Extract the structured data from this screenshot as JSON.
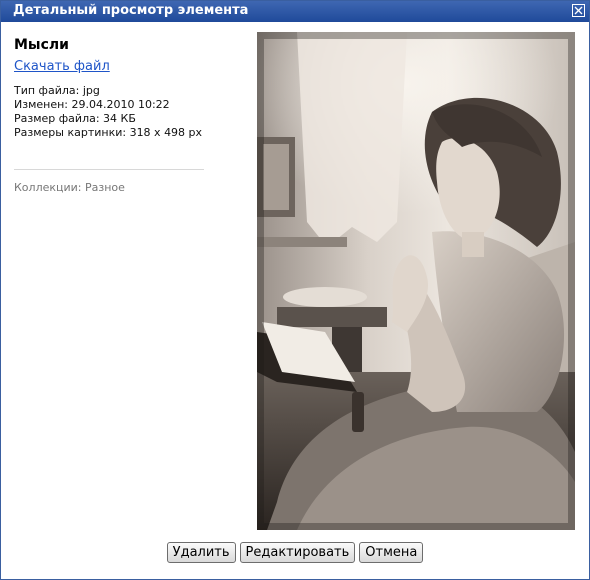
{
  "window": {
    "title": "Детальный просмотр элемента"
  },
  "item": {
    "name": "Мысли",
    "download_label": "Скачать файл",
    "file_type": "Тип файла: jpg",
    "modified": "Изменен: 29.04.2010 10:22",
    "file_size": "Размер файла: 34 КБ",
    "image_size": "Размеры картинки: 318 x 498 px",
    "collections": "Коллекции: Разное"
  },
  "image": {
    "subject": "sepia photo of a girl reading a book by a window"
  },
  "buttons": {
    "delete": "Удалить",
    "edit": "Редактировать",
    "cancel": "Отмена"
  },
  "colors": {
    "titlebar": "#2a56a6",
    "link": "#1f55c8"
  }
}
